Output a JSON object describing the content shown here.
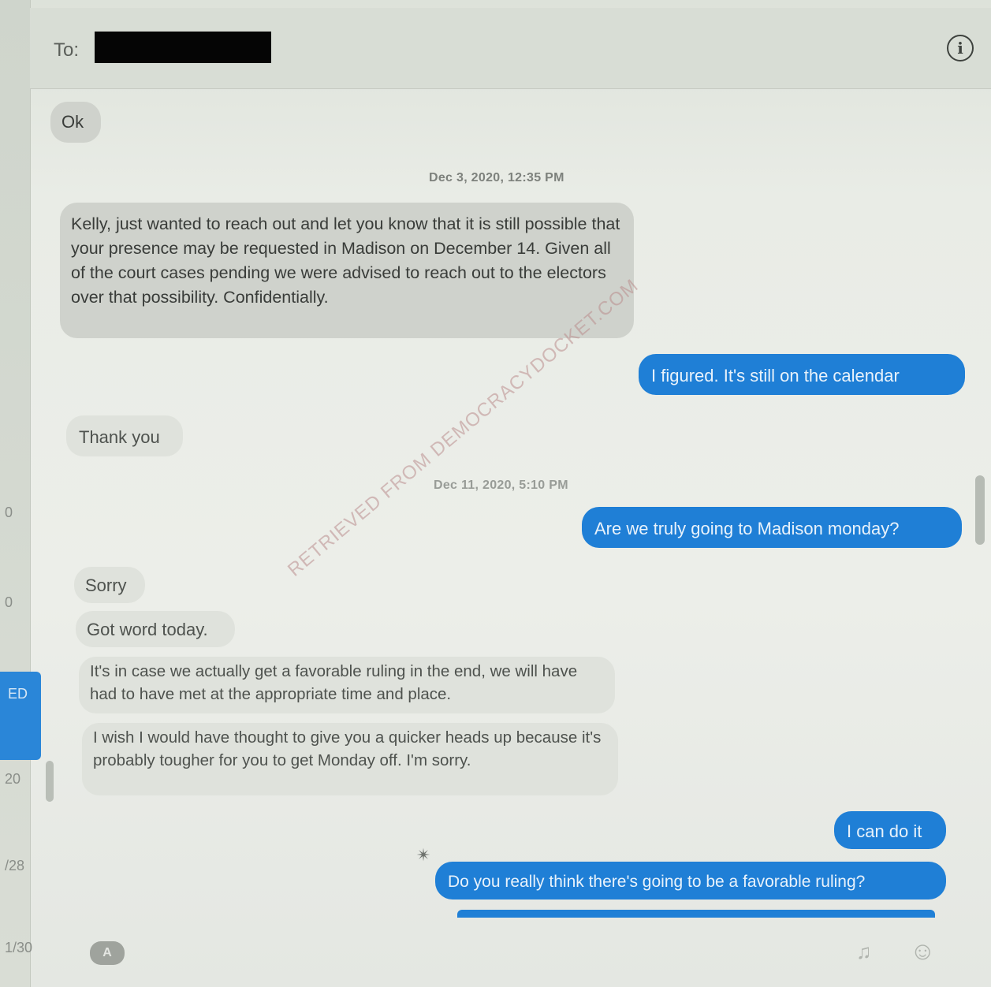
{
  "header": {
    "to_label": "To:",
    "info_icon": "info-icon"
  },
  "sidebar": {
    "fragments": [
      "0",
      "0",
      "20",
      "/28",
      "1/30"
    ],
    "selected_fragment": "ED"
  },
  "messages": [
    {
      "dir": "in",
      "text": "Ok"
    },
    {
      "type": "timestamp",
      "text": "Dec 3, 2020, 12:35 PM"
    },
    {
      "dir": "in",
      "text": "Kelly, just wanted to reach out and let you know that it is still possible that your presence may be requested in Madison on December 14. Given all of the court cases pending we were advised to reach out to the electors over that possibility. Confidentially."
    },
    {
      "dir": "out",
      "text": "I figured. It's still on the calendar"
    },
    {
      "dir": "in",
      "text": "Thank you"
    },
    {
      "type": "timestamp",
      "text": "Dec 11, 2020, 5:10 PM"
    },
    {
      "dir": "out",
      "text": "Are we truly going to Madison monday?"
    },
    {
      "dir": "in",
      "text": "Sorry"
    },
    {
      "dir": "in",
      "text": "Got word today."
    },
    {
      "dir": "in",
      "text": "It's in case we actually get a favorable ruling in the end, we will have had to have met at the appropriate time and place."
    },
    {
      "dir": "in",
      "text": "I wish I would have thought to give you a quicker heads up because it's probably tougher for you to get Monday off. I'm sorry."
    },
    {
      "dir": "out",
      "text": "I can do it"
    },
    {
      "dir": "out",
      "text": "Do you really think there's going to be a favorable ruling?"
    }
  ],
  "watermark": "RETRIEVED FROM DEMOCRACYDOCKET.COM",
  "footer": {
    "apps_icon": "app-store-icon",
    "audio_icon": "audio-waveform-icon",
    "emoji_icon": "emoji-icon"
  },
  "colors": {
    "outgoing_bubble": "#1f7fd6",
    "incoming_bubble": "#cfd2cc",
    "background": "#eceee9"
  }
}
